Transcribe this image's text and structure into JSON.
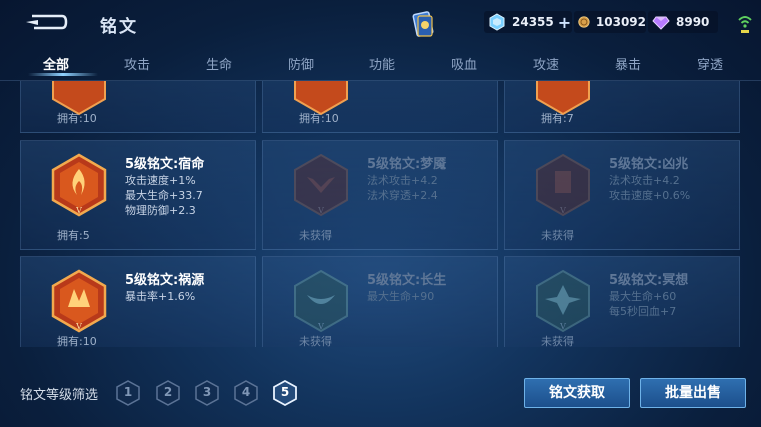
{
  "header": {
    "title": "铭文",
    "back_icon": "back-arrow-icon",
    "resources": {
      "diamonds": "24355",
      "diamonds_plus": "+",
      "gold": "103092",
      "gems": "8990"
    }
  },
  "tabs": [
    {
      "label": "全部",
      "active": true
    },
    {
      "label": "攻击",
      "active": false
    },
    {
      "label": "生命",
      "active": false
    },
    {
      "label": "防御",
      "active": false
    },
    {
      "label": "功能",
      "active": false
    },
    {
      "label": "吸血",
      "active": false
    },
    {
      "label": "攻速",
      "active": false
    },
    {
      "label": "暴击",
      "active": false
    },
    {
      "label": "穿透",
      "active": false
    }
  ],
  "cards": [
    {
      "owned": "拥有:10"
    },
    {
      "owned": "拥有:10"
    },
    {
      "owned": "拥有:7"
    },
    {
      "name": "5级铭文:宿命",
      "stats": [
        "攻击速度+1%",
        "最大生命+33.7",
        "物理防御+2.3"
      ],
      "owned": "拥有:5",
      "locked": false
    },
    {
      "name": "5级铭文:梦魇",
      "stats": [
        "法术攻击+4.2",
        "法术穿透+2.4"
      ],
      "owned": "未获得",
      "locked": true
    },
    {
      "name": "5级铭文:凶兆",
      "stats": [
        "法术攻击+4.2",
        "攻击速度+0.6%"
      ],
      "owned": "未获得",
      "locked": true
    },
    {
      "name": "5级铭文:祸源",
      "stats": [
        "暴击率+1.6%"
      ],
      "owned": "拥有:10",
      "locked": false
    },
    {
      "name": "5级铭文:长生",
      "stats": [
        "最大生命+90"
      ],
      "owned": "未获得",
      "locked": true
    },
    {
      "name": "5级铭文:冥想",
      "stats": [
        "最大生命+60",
        "每5秒回血+7"
      ],
      "owned": "未获得",
      "locked": true
    }
  ],
  "footer": {
    "filter_label": "铭文等级筛选",
    "levels": [
      "1",
      "2",
      "3",
      "4",
      "5"
    ],
    "active_level": "5",
    "get_button": "铭文获取",
    "sell_button": "批量出售"
  },
  "colors": {
    "accent": "#8fd1ff",
    "button": "#2f6fb0",
    "badge_orange": "#d86a1f",
    "badge_red": "#b6361f"
  }
}
